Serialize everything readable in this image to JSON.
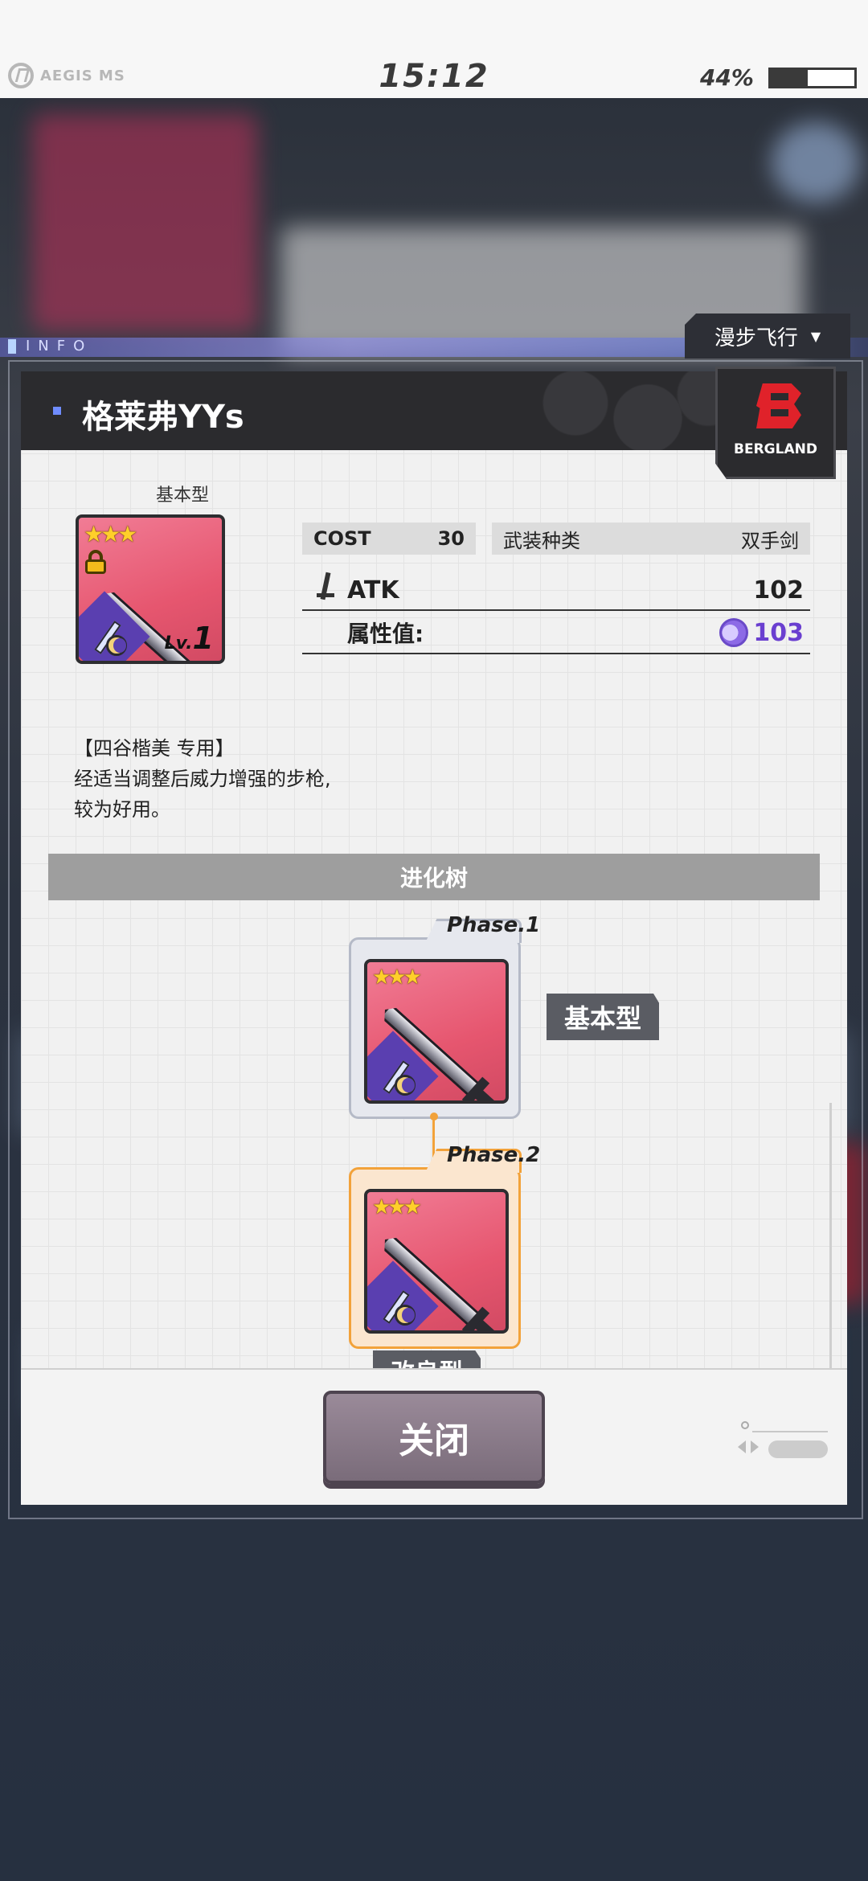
{
  "status_bar": {
    "brand": "AEGIS MS",
    "time": "15:12",
    "battery_percent": "44%",
    "battery_level": 0.44
  },
  "info_label": "INFO",
  "flight_mode": {
    "label": "漫步飞行"
  },
  "maker": {
    "name": "BERGLAND",
    "color": "#e0222a"
  },
  "weapon": {
    "title": "格莱弗YYs",
    "type_label": "基本型",
    "stars": "★★★",
    "level_prefix": "Lv.",
    "level": "1",
    "cost_label": "COST",
    "cost_value": "30",
    "weapon_type_label": "武装种类",
    "weapon_type_value": "双手剑",
    "atk_label": "ATK",
    "atk_value": "102",
    "attr_label": "属性值:",
    "attr_value": "103",
    "description_line1": "【四谷楷美 专用】",
    "description_line2": "经适当调整后威力增强的步枪,",
    "description_line3": "较为好用。"
  },
  "evolution": {
    "title": "进化树",
    "phases": [
      {
        "label": "Phase.1",
        "stars": "★★★",
        "type": "基本型"
      },
      {
        "label": "Phase.2",
        "stars": "★★★",
        "type": "改良型"
      }
    ]
  },
  "close_button": "关闭",
  "colors": {
    "accent_orange": "#f2a23a",
    "attr_purple": "#6a3fd0",
    "header_dark": "#2b2b2e"
  }
}
